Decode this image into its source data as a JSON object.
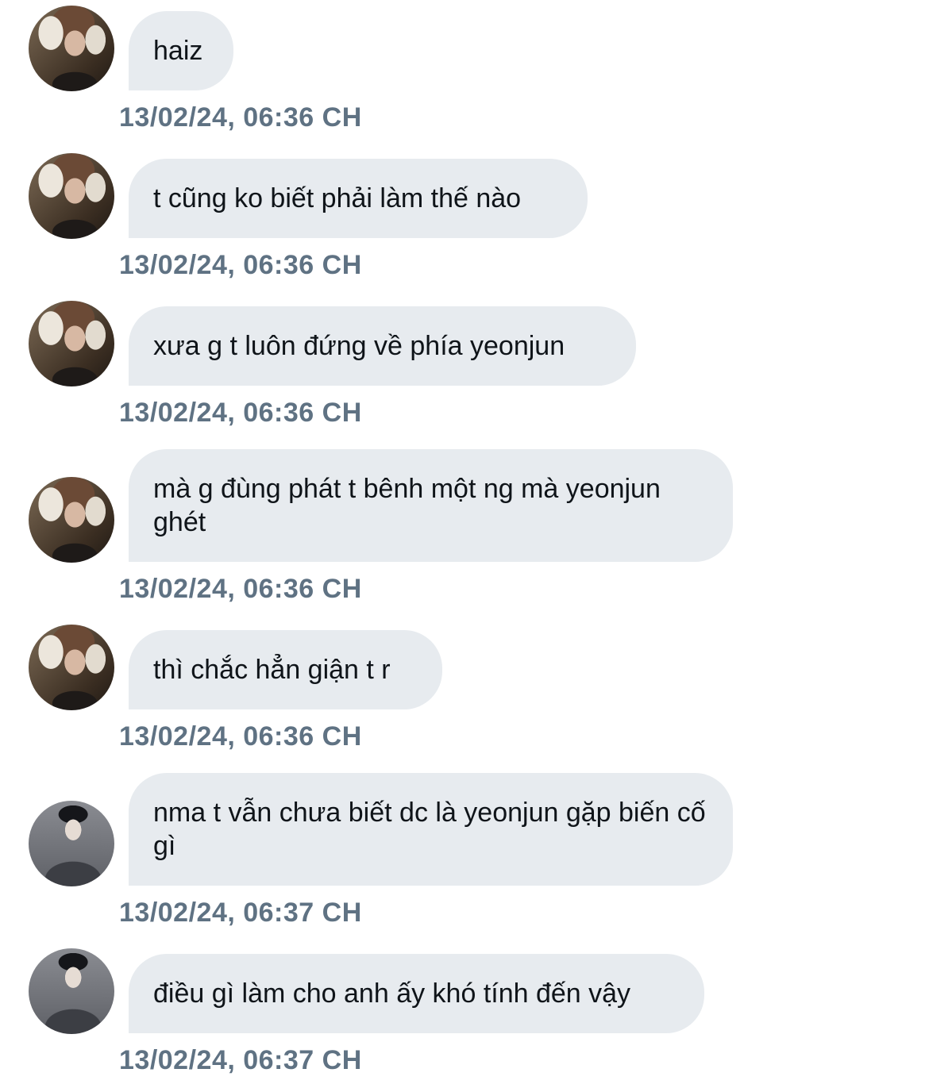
{
  "messages": [
    {
      "avatar": "user-a",
      "text": "haiz",
      "time": "13/02/24, 06:36 CH"
    },
    {
      "avatar": "user-a",
      "text": "t cũng ko biết phải làm thế nào",
      "time": "13/02/24, 06:36 CH"
    },
    {
      "avatar": "user-a",
      "text": "xưa g t luôn đứng về phía yeonjun",
      "time": "13/02/24, 06:36 CH"
    },
    {
      "avatar": "user-a",
      "text": "mà g đùng phát t bênh một ng mà yeonjun ghét",
      "time": "13/02/24, 06:36 CH"
    },
    {
      "avatar": "user-a",
      "text": "thì chắc hẳn giận t r",
      "time": "13/02/24, 06:36 CH"
    },
    {
      "avatar": "user-b",
      "text": "nma t vẫn chưa biết dc là yeonjun gặp biến cố gì",
      "time": "13/02/24, 06:37 CH"
    },
    {
      "avatar": "user-b",
      "text": "điều gì làm cho anh ấy khó tính đến vậy",
      "time": "13/02/24, 06:37 CH"
    }
  ]
}
